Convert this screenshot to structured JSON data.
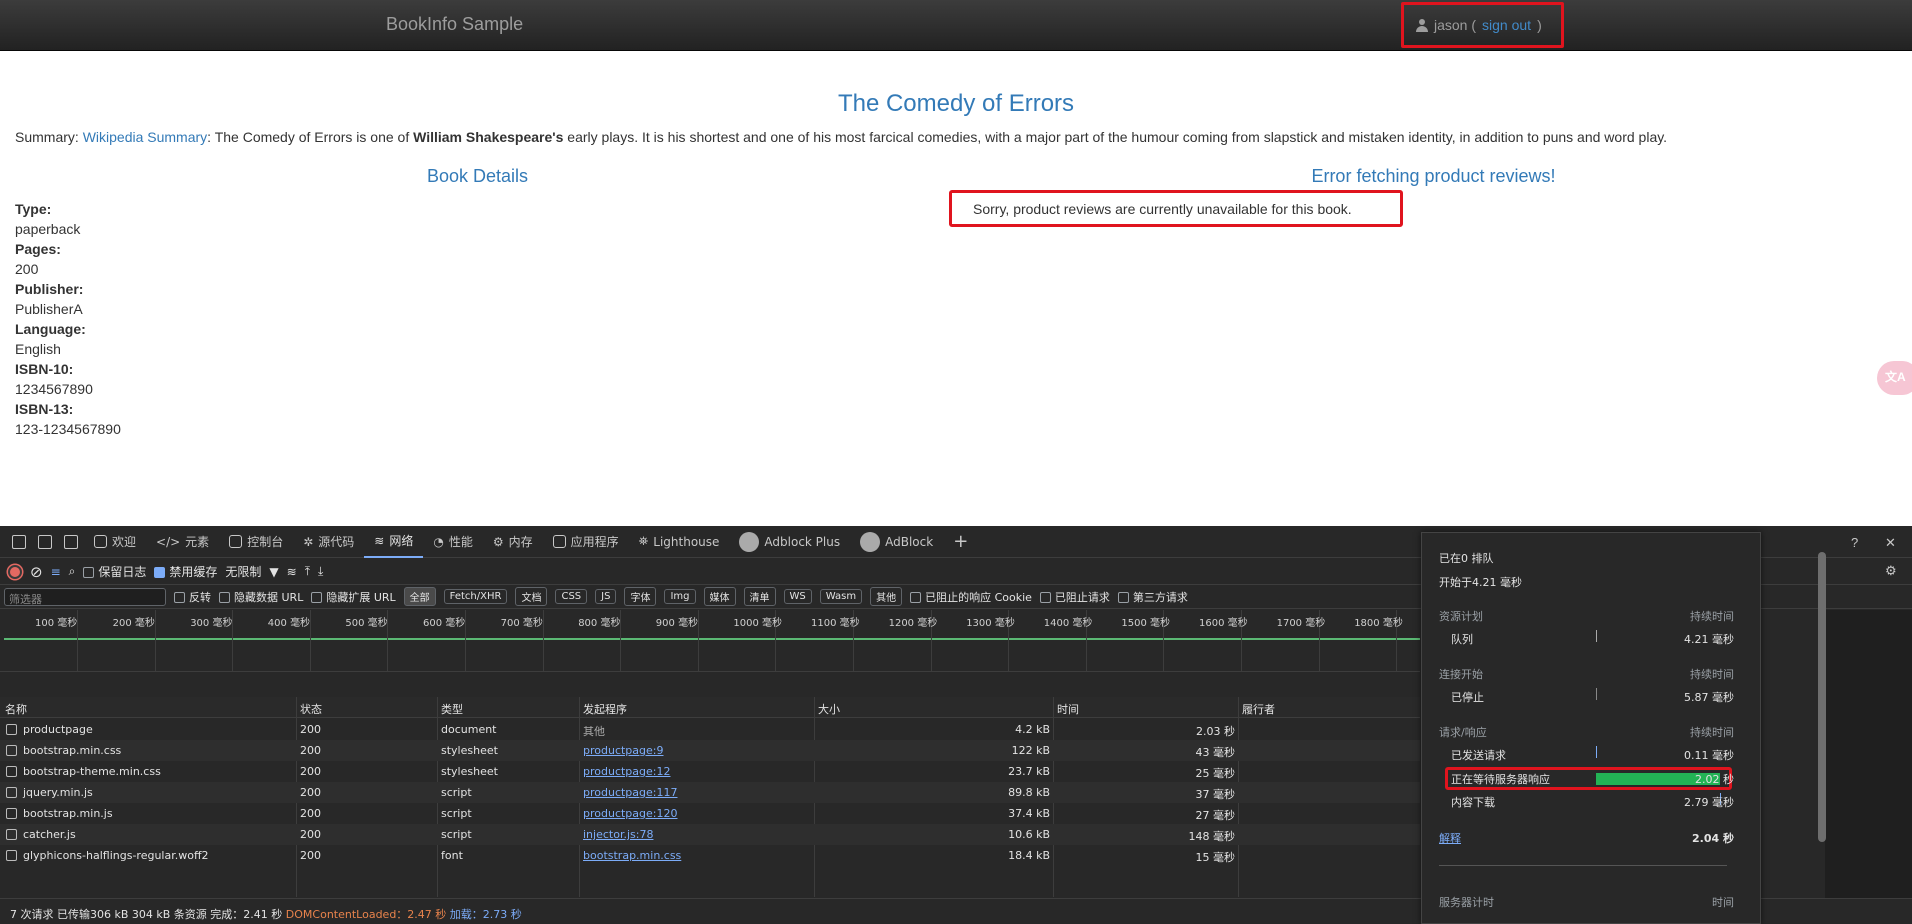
{
  "navbar": {
    "brand": "BookInfo Sample",
    "user": "jason (",
    "sign_out": "sign out",
    "close_paren": ")"
  },
  "book": {
    "title": "The Comedy of Errors",
    "summary_label": "Summary:",
    "summary_link": "Wikipedia Summary",
    "summary_pre": ": The Comedy of Errors is one of",
    "summary_bold": "William Shakespeare's",
    "summary_post": "early plays. It is his shortest and one of his most farcical comedies, with a major part of the humour coming from slapstick and mistaken identity, in addition to puns and word play."
  },
  "details": {
    "heading": "Book Details",
    "fields": [
      {
        "label": "Type:",
        "value": "paperback"
      },
      {
        "label": "Pages:",
        "value": "200"
      },
      {
        "label": "Publisher:",
        "value": "PublisherA"
      },
      {
        "label": "Language:",
        "value": "English"
      },
      {
        "label": "ISBN-10:",
        "value": "1234567890"
      },
      {
        "label": "ISBN-13:",
        "value": "123-1234567890"
      }
    ]
  },
  "reviews": {
    "heading": "Error fetching product reviews!",
    "message": "Sorry, product reviews are currently unavailable for this book."
  },
  "devtools": {
    "tabs": [
      "欢迎",
      "元素",
      "控制台",
      "源代码",
      "网络",
      "性能",
      "内存",
      "应用程序",
      "Lighthouse",
      "Adblock Plus",
      "AdBlock"
    ],
    "active_tab": "网络",
    "toolbar": {
      "preserve_log": "保留日志",
      "disable_cache": "禁用缓存",
      "throttle": "无限制"
    },
    "filter": {
      "placeholder": "筛选器",
      "invert": "反转",
      "hide_data_url": "隐藏数据 URL",
      "hide_ext_url": "隐藏扩展 URL",
      "chips": [
        "全部",
        "Fetch/XHR",
        "文档",
        "CSS",
        "JS",
        "字体",
        "Img",
        "媒体",
        "清单",
        "WS",
        "Wasm",
        "其他"
      ],
      "blocked_cookies": "已阻止的响应 Cookie",
      "blocked_requests": "已阻止请求",
      "third_party": "第三方请求"
    },
    "timeline_ticks": [
      "100 毫秒",
      "200 毫秒",
      "300 毫秒",
      "400 毫秒",
      "500 毫秒",
      "600 毫秒",
      "700 毫秒",
      "800 毫秒",
      "900 毫秒",
      "1000 毫秒",
      "1100 毫秒",
      "1200 毫秒",
      "1300 毫秒",
      "1400 毫秒",
      "1500 毫秒",
      "1600 毫秒",
      "1700 毫秒",
      "1800 毫秒"
    ],
    "columns": [
      "名称",
      "状态",
      "类型",
      "发起程序",
      "大小",
      "时间",
      "履行者"
    ],
    "rows": [
      {
        "name": "productpage",
        "status": "200",
        "type": "document",
        "initiator": "其他",
        "size": "4.2 kB",
        "time": "2.03 秒"
      },
      {
        "name": "bootstrap.min.css",
        "status": "200",
        "type": "stylesheet",
        "initiator": "productpage:9",
        "size": "122 kB",
        "time": "43 毫秒"
      },
      {
        "name": "bootstrap-theme.min.css",
        "status": "200",
        "type": "stylesheet",
        "initiator": "productpage:12",
        "size": "23.7 kB",
        "time": "25 毫秒"
      },
      {
        "name": "jquery.min.js",
        "status": "200",
        "type": "script",
        "initiator": "productpage:117",
        "size": "89.8 kB",
        "time": "37 毫秒"
      },
      {
        "name": "bootstrap.min.js",
        "status": "200",
        "type": "script",
        "initiator": "productpage:120",
        "size": "37.4 kB",
        "time": "27 毫秒"
      },
      {
        "name": "catcher.js",
        "status": "200",
        "type": "script",
        "initiator": "injector.js:78",
        "size": "10.6 kB",
        "time": "148 毫秒"
      },
      {
        "name": "glyphicons-halflings-regular.woff2",
        "status": "200",
        "type": "font",
        "initiator": "bootstrap.min.css",
        "size": "18.4 kB",
        "time": "15 毫秒"
      }
    ],
    "status_bar": {
      "summary": "7 次请求  已传输306 kB  304 kB 条资源  完成：2.41 秒",
      "dom": "DOMContentLoaded：2.47 秒",
      "load": "加载：2.73 秒"
    }
  },
  "timing": {
    "queued_at": "已在0 排队",
    "started_at": "开始于4.21 毫秒",
    "sections": [
      {
        "title": "资源计划",
        "dur_label": "持续时间",
        "items": [
          {
            "label": "队列",
            "value": "4.21 毫秒"
          }
        ]
      },
      {
        "title": "连接开始",
        "dur_label": "持续时间",
        "items": [
          {
            "label": "已停止",
            "value": "5.87 毫秒"
          }
        ]
      },
      {
        "title": "请求/响应",
        "dur_label": "持续时间",
        "items": [
          {
            "label": "已发送请求",
            "value": "0.11 毫秒"
          },
          {
            "label": "正在等待服务器响应",
            "value": "2.02 秒"
          },
          {
            "label": "内容下载",
            "value": "2.79 毫秒"
          }
        ]
      }
    ],
    "explain": "解释",
    "total": "2.04 秒",
    "server_timing": "服务器计时",
    "time_label": "时间"
  }
}
